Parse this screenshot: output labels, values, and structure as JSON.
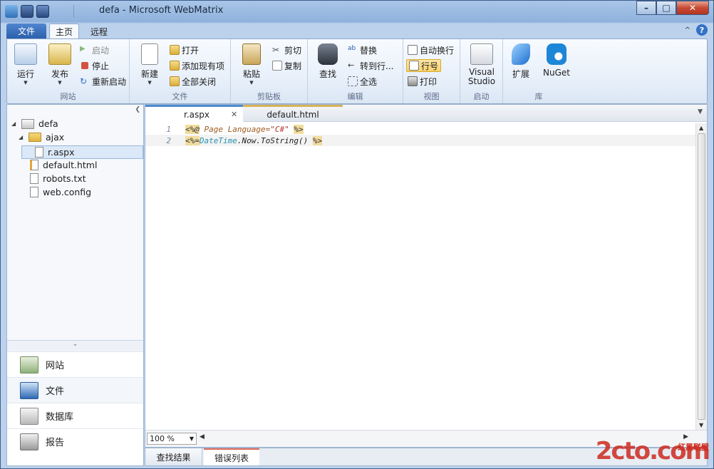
{
  "window": {
    "title": "defa - Microsoft WebMatrix",
    "controls": {
      "minimize": "–",
      "maximize": "□",
      "close": "✕"
    }
  },
  "ribbon_tabs": {
    "file": "文件",
    "home": "主页",
    "remote": "远程",
    "help": "?",
    "collapse": "^"
  },
  "ribbon": {
    "site_group": {
      "label": "网站",
      "run": "运行",
      "publish": "发布",
      "start": "启动",
      "stop": "停止",
      "restart": "重新启动"
    },
    "file_group": {
      "label": "文件",
      "new": "新建",
      "open": "打开",
      "add_existing": "添加现有项",
      "close_all": "全部关闭"
    },
    "clipboard_group": {
      "label": "剪贴板",
      "paste": "粘贴",
      "cut": "剪切",
      "copy": "复制"
    },
    "edit_group": {
      "label": "编辑",
      "find": "查找",
      "replace": "替换",
      "goto": "转到行...",
      "select_all": "全选"
    },
    "view_group": {
      "label": "视图",
      "word_wrap": "自动换行",
      "line_numbers": "行号",
      "print": "打印"
    },
    "launch_group": {
      "label": "启动",
      "visual_studio": "Visual Studio"
    },
    "library_group": {
      "label": "库",
      "extensions": "扩展",
      "nuget": "NuGet"
    }
  },
  "tree": {
    "root": "defa",
    "folder": "ajax",
    "items": [
      "r.aspx",
      "default.html",
      "robots.txt",
      "web.config"
    ]
  },
  "workspaces": [
    "网站",
    "文件",
    "数据库",
    "报告"
  ],
  "editor": {
    "tabs": [
      "r.aspx",
      "default.html"
    ],
    "lines": [
      {
        "num": "1",
        "open": "<%@",
        "kw": "Page",
        "attr": "Language=",
        "val": "\"C#\"",
        "close": "%>"
      },
      {
        "num": "2",
        "open": "<%=",
        "type": "DateTime",
        "rest": ".Now.ToString()",
        "close": "%>"
      }
    ],
    "zoom": "100 %"
  },
  "bottom_tabs": [
    "查找结果",
    "错误列表"
  ],
  "watermark": {
    "main": "2cto.com",
    "sub": "红黑联盟"
  }
}
